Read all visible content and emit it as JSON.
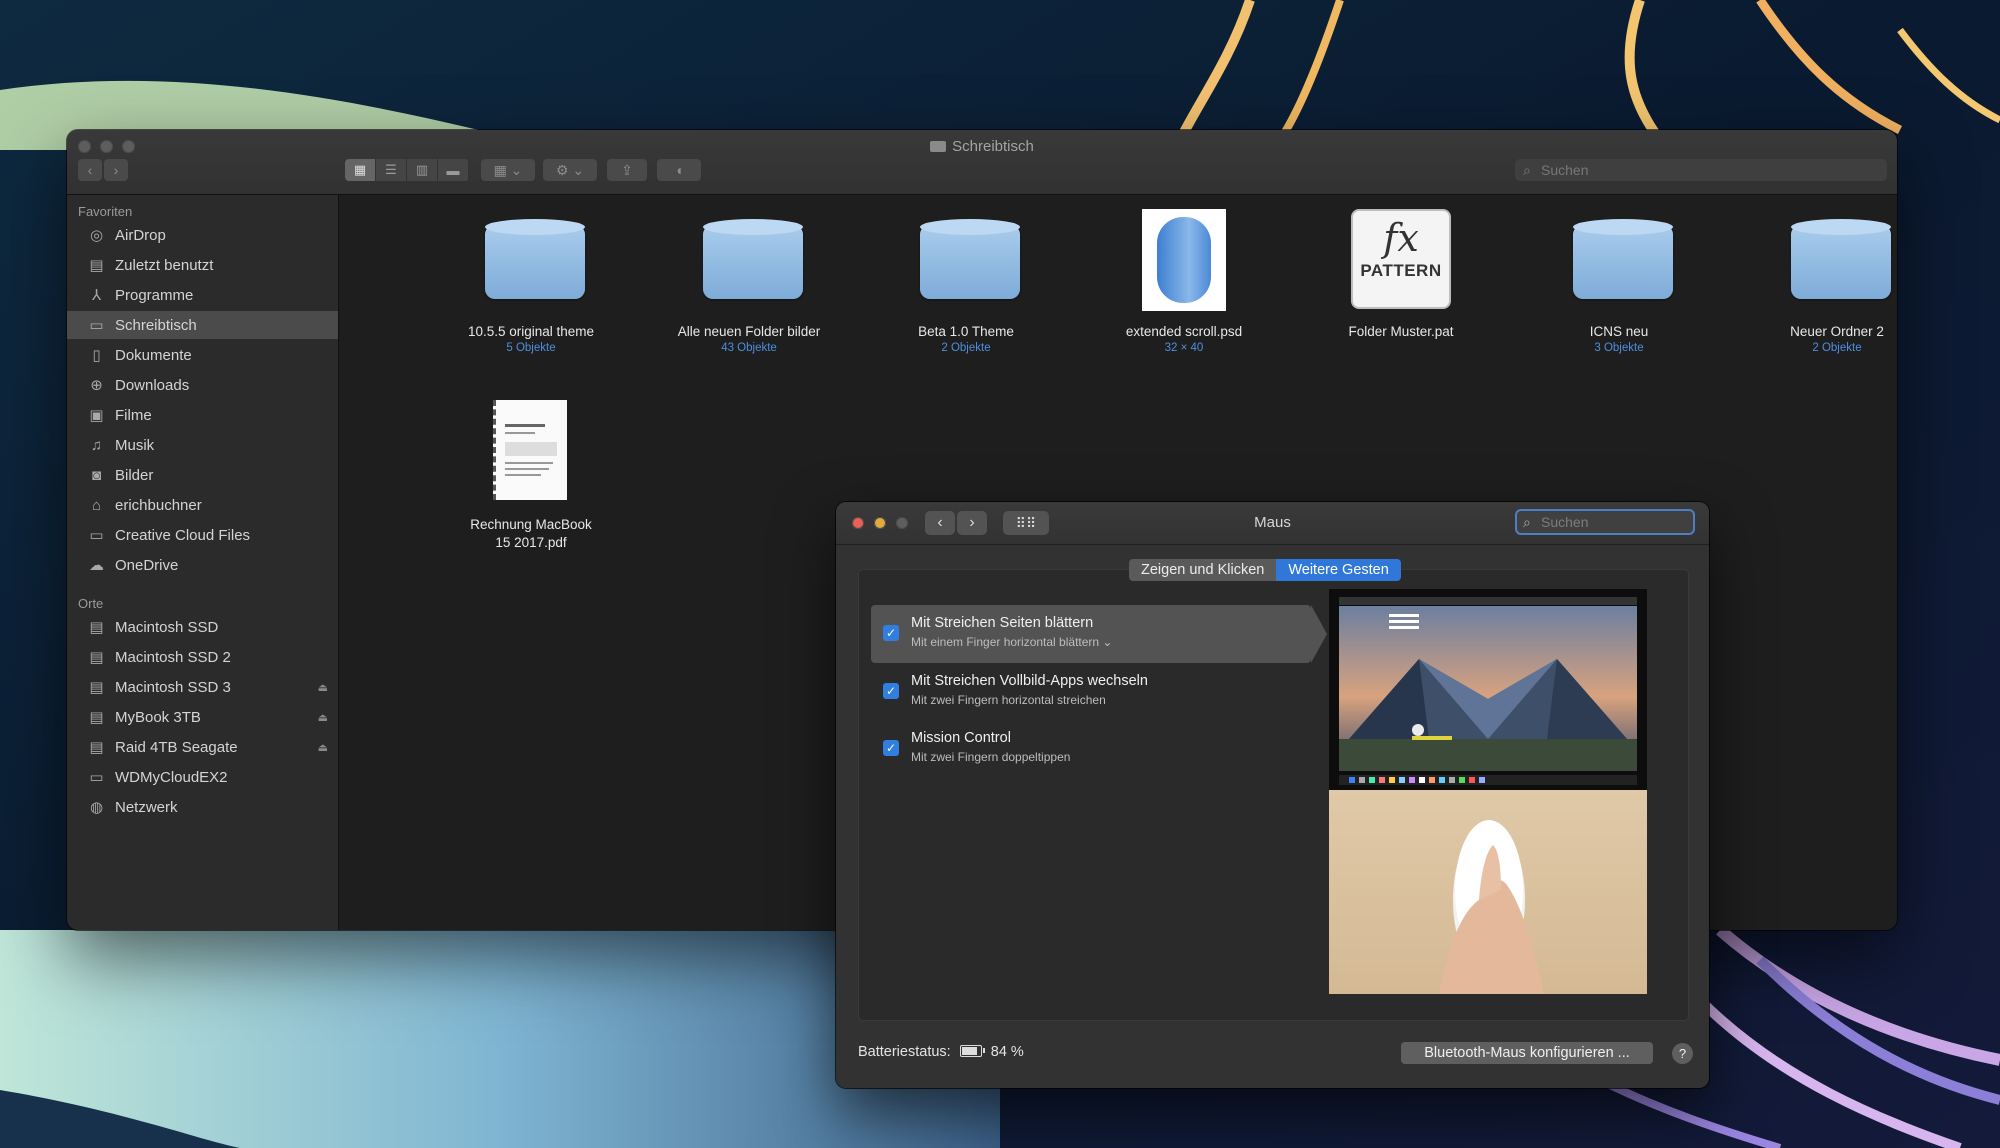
{
  "finder": {
    "title": "Schreibtisch",
    "search_placeholder": "Suchen",
    "sidebar": {
      "favorites_header": "Favoriten",
      "favorites": [
        {
          "label": "AirDrop",
          "icon": "airdrop-icon"
        },
        {
          "label": "Zuletzt benutzt",
          "icon": "recents-icon"
        },
        {
          "label": "Programme",
          "icon": "applications-icon"
        },
        {
          "label": "Schreibtisch",
          "icon": "desktop-icon",
          "selected": true
        },
        {
          "label": "Dokumente",
          "icon": "documents-icon"
        },
        {
          "label": "Downloads",
          "icon": "downloads-icon"
        },
        {
          "label": "Filme",
          "icon": "movies-icon"
        },
        {
          "label": "Musik",
          "icon": "music-icon"
        },
        {
          "label": "Bilder",
          "icon": "pictures-icon"
        },
        {
          "label": "erichbuchner",
          "icon": "home-icon"
        },
        {
          "label": "Creative Cloud Files",
          "icon": "folder-icon"
        },
        {
          "label": "OneDrive",
          "icon": "cloud-icon"
        }
      ],
      "places_header": "Orte",
      "places": [
        {
          "label": "Macintosh SSD",
          "icon": "drive-icon"
        },
        {
          "label": "Macintosh SSD 2",
          "icon": "drive-icon"
        },
        {
          "label": "Macintosh SSD 3",
          "icon": "drive-icon",
          "eject": true
        },
        {
          "label": "MyBook 3TB",
          "icon": "drive-icon",
          "eject": true
        },
        {
          "label": "Raid 4TB Seagate",
          "icon": "drive-icon",
          "eject": true
        },
        {
          "label": "WDMyCloudEX2",
          "icon": "monitor-icon"
        },
        {
          "label": "Netzwerk",
          "icon": "network-icon"
        }
      ]
    },
    "files": [
      {
        "name": "10.5.5 original theme",
        "sub": "5 Objekte",
        "kind": "folder"
      },
      {
        "name": "Alle neuen Folder bilder",
        "sub": "43 Objekte",
        "kind": "folder"
      },
      {
        "name": "Beta 1.0 Theme",
        "sub": "2 Objekte",
        "kind": "folder"
      },
      {
        "name": "extended scroll.psd",
        "sub": "32 × 40",
        "kind": "psd"
      },
      {
        "name": "Folder Muster.pat",
        "sub": "",
        "kind": "pattern",
        "badge_fx": "fx",
        "badge_text": "PATTERN"
      },
      {
        "name": "ICNS neu",
        "sub": "3 Objekte",
        "kind": "folder"
      },
      {
        "name": "Neuer Ordner 2",
        "sub": "2 Objekte",
        "kind": "folder"
      },
      {
        "name": "Rechnung MacBook 15 2017.pdf",
        "sub": "",
        "kind": "pdf"
      }
    ]
  },
  "maus": {
    "title": "Maus",
    "search_placeholder": "Suchen",
    "tabs": [
      "Zeigen und Klicken",
      "Weitere Gesten"
    ],
    "active_tab": 1,
    "gestures": [
      {
        "title": "Mit Streichen Seiten blättern",
        "sub": "Mit einem Finger horizontal blättern ⌄",
        "checked": true,
        "selected": true
      },
      {
        "title": "Mit Streichen Vollbild-Apps wechseln",
        "sub": "Mit zwei Fingern horizontal streichen",
        "checked": true
      },
      {
        "title": "Mission Control",
        "sub": "Mit zwei Fingern doppeltippen",
        "checked": true
      }
    ],
    "battery_label": "Batteriestatus:",
    "battery_value": "84 %",
    "bluetooth_button": "Bluetooth-Maus konfigurieren ...",
    "help_label": "?"
  }
}
